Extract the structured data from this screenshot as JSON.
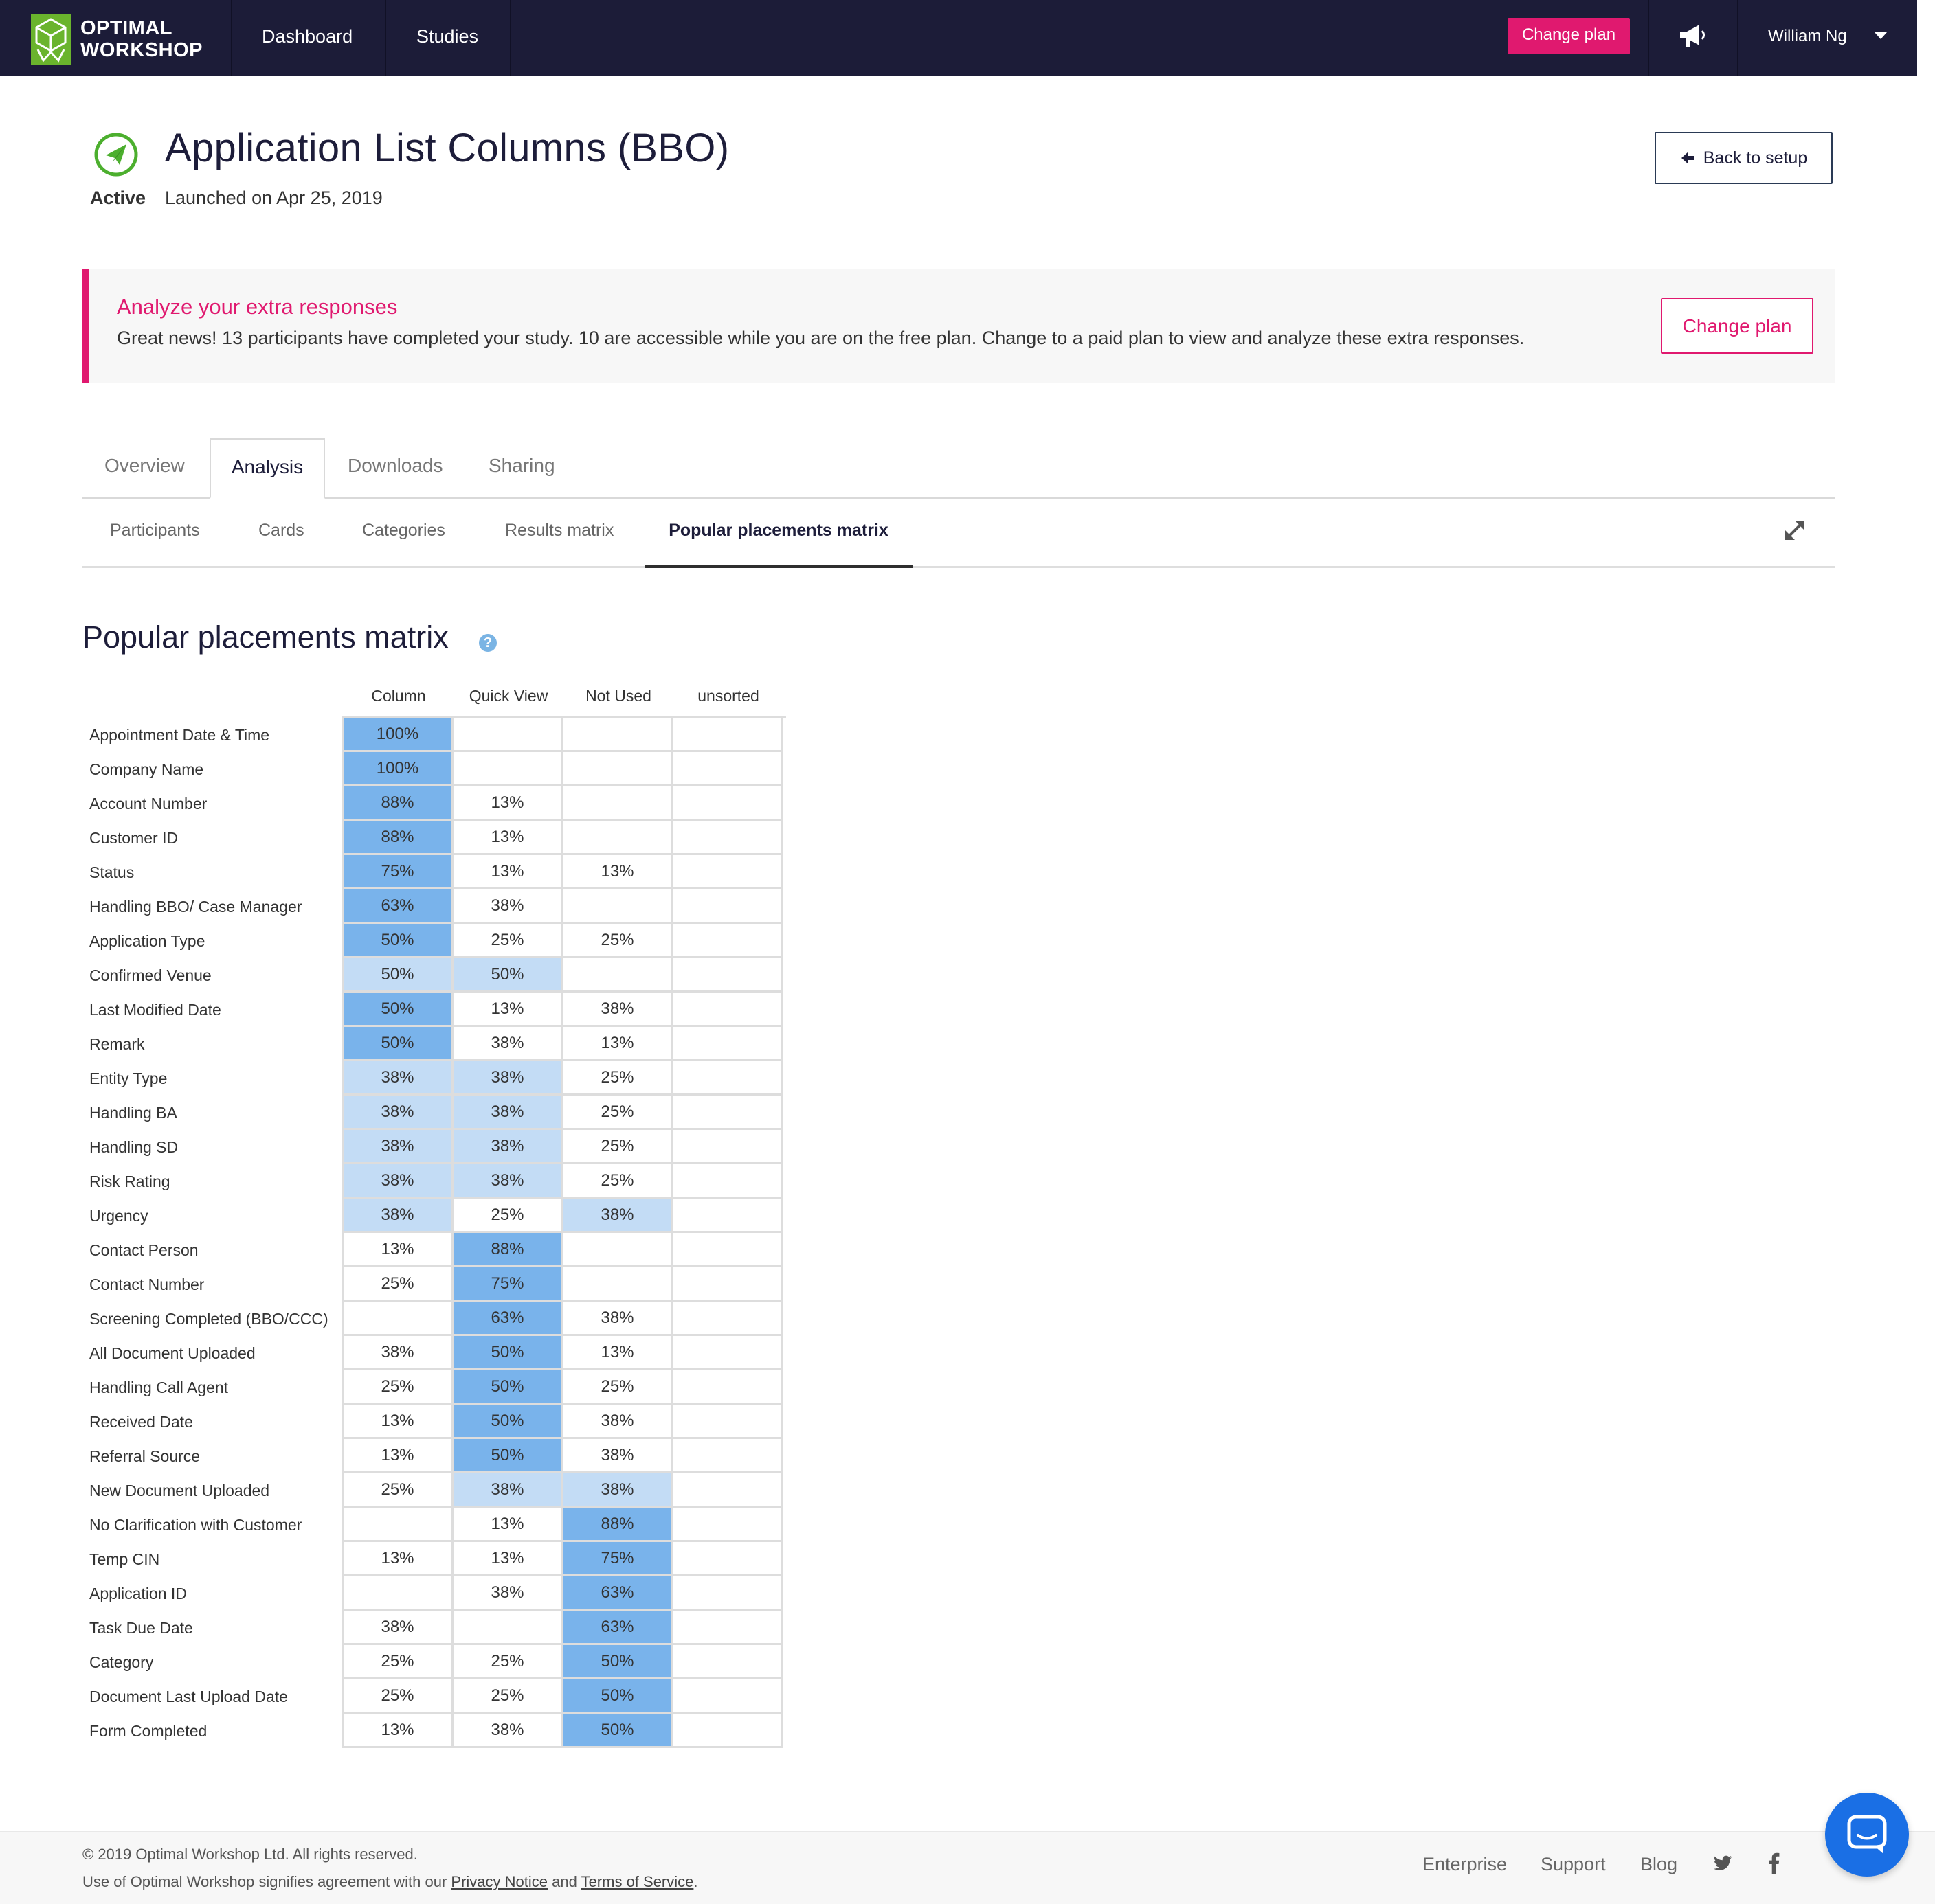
{
  "nav": {
    "brand_line1": "OPTIMAL",
    "brand_line2": "WORKSHOP",
    "links": [
      "Dashboard",
      "Studies"
    ],
    "cta": "Change plan",
    "user": "William Ng",
    "icons": {
      "logo": "optimal-workshop-logo",
      "announcements": "megaphone-icon",
      "menu": "caret-down-icon"
    }
  },
  "header": {
    "title": "Application List Columns (BBO)",
    "status": "Active",
    "launched": "Launched on Apr 25, 2019",
    "back_button": "Back to setup"
  },
  "banner": {
    "title": "Analyze your extra responses",
    "body": "Great news! 13 participants have completed your study. 10 are accessible while you are on the free plan. Change to a paid plan to view and analyze these extra responses.",
    "button": "Change plan"
  },
  "tabs": [
    "Overview",
    "Analysis",
    "Downloads",
    "Sharing"
  ],
  "active_tab": "Analysis",
  "subtabs": [
    "Participants",
    "Cards",
    "Categories",
    "Results matrix",
    "Popular placements matrix"
  ],
  "active_subtab": "Popular placements matrix",
  "matrix": {
    "title": "Popular placements matrix",
    "columns": [
      "Column",
      "Quick View",
      "Not Used",
      "unsorted"
    ],
    "colors": {
      "strong": "#79b3eb",
      "light": "#c3dcf5",
      "none": "#ffffff",
      "border": "#dddddd"
    },
    "rows": [
      {
        "label": "Appointment Date & Time",
        "cells": [
          "100%",
          "",
          "",
          ""
        ],
        "shade": [
          "strong",
          "none",
          "none",
          "none"
        ]
      },
      {
        "label": "Company Name",
        "cells": [
          "100%",
          "",
          "",
          ""
        ],
        "shade": [
          "strong",
          "none",
          "none",
          "none"
        ]
      },
      {
        "label": "Account Number",
        "cells": [
          "88%",
          "13%",
          "",
          ""
        ],
        "shade": [
          "strong",
          "none",
          "none",
          "none"
        ]
      },
      {
        "label": "Customer ID",
        "cells": [
          "88%",
          "13%",
          "",
          ""
        ],
        "shade": [
          "strong",
          "none",
          "none",
          "none"
        ]
      },
      {
        "label": "Status",
        "cells": [
          "75%",
          "13%",
          "13%",
          ""
        ],
        "shade": [
          "strong",
          "none",
          "none",
          "none"
        ]
      },
      {
        "label": "Handling BBO/ Case Manager",
        "cells": [
          "63%",
          "38%",
          "",
          ""
        ],
        "shade": [
          "strong",
          "none",
          "none",
          "none"
        ]
      },
      {
        "label": "Application Type",
        "cells": [
          "50%",
          "25%",
          "25%",
          ""
        ],
        "shade": [
          "strong",
          "none",
          "none",
          "none"
        ]
      },
      {
        "label": "Confirmed Venue",
        "cells": [
          "50%",
          "50%",
          "",
          ""
        ],
        "shade": [
          "light",
          "light",
          "none",
          "none"
        ]
      },
      {
        "label": "Last Modified Date",
        "cells": [
          "50%",
          "13%",
          "38%",
          ""
        ],
        "shade": [
          "strong",
          "none",
          "none",
          "none"
        ]
      },
      {
        "label": "Remark",
        "cells": [
          "50%",
          "38%",
          "13%",
          ""
        ],
        "shade": [
          "strong",
          "none",
          "none",
          "none"
        ]
      },
      {
        "label": "Entity Type",
        "cells": [
          "38%",
          "38%",
          "25%",
          ""
        ],
        "shade": [
          "light",
          "light",
          "none",
          "none"
        ]
      },
      {
        "label": "Handling BA",
        "cells": [
          "38%",
          "38%",
          "25%",
          ""
        ],
        "shade": [
          "light",
          "light",
          "none",
          "none"
        ]
      },
      {
        "label": "Handling SD",
        "cells": [
          "38%",
          "38%",
          "25%",
          ""
        ],
        "shade": [
          "light",
          "light",
          "none",
          "none"
        ]
      },
      {
        "label": "Risk Rating",
        "cells": [
          "38%",
          "38%",
          "25%",
          ""
        ],
        "shade": [
          "light",
          "light",
          "none",
          "none"
        ]
      },
      {
        "label": "Urgency",
        "cells": [
          "38%",
          "25%",
          "38%",
          ""
        ],
        "shade": [
          "light",
          "none",
          "light",
          "none"
        ]
      },
      {
        "label": "Contact Person",
        "cells": [
          "13%",
          "88%",
          "",
          ""
        ],
        "shade": [
          "none",
          "strong",
          "none",
          "none"
        ]
      },
      {
        "label": "Contact Number",
        "cells": [
          "25%",
          "75%",
          "",
          ""
        ],
        "shade": [
          "none",
          "strong",
          "none",
          "none"
        ]
      },
      {
        "label": "Screening Completed (BBO/CCC)",
        "cells": [
          "",
          "63%",
          "38%",
          ""
        ],
        "shade": [
          "none",
          "strong",
          "none",
          "none"
        ]
      },
      {
        "label": "All Document Uploaded",
        "cells": [
          "38%",
          "50%",
          "13%",
          ""
        ],
        "shade": [
          "none",
          "strong",
          "none",
          "none"
        ]
      },
      {
        "label": "Handling Call Agent",
        "cells": [
          "25%",
          "50%",
          "25%",
          ""
        ],
        "shade": [
          "none",
          "strong",
          "none",
          "none"
        ]
      },
      {
        "label": "Received Date",
        "cells": [
          "13%",
          "50%",
          "38%",
          ""
        ],
        "shade": [
          "none",
          "strong",
          "none",
          "none"
        ]
      },
      {
        "label": "Referral Source",
        "cells": [
          "13%",
          "50%",
          "38%",
          ""
        ],
        "shade": [
          "none",
          "strong",
          "none",
          "none"
        ]
      },
      {
        "label": "New Document Uploaded",
        "cells": [
          "25%",
          "38%",
          "38%",
          ""
        ],
        "shade": [
          "none",
          "light",
          "light",
          "none"
        ]
      },
      {
        "label": "No Clarification with Customer",
        "cells": [
          "",
          "13%",
          "88%",
          ""
        ],
        "shade": [
          "none",
          "none",
          "strong",
          "none"
        ]
      },
      {
        "label": "Temp CIN",
        "cells": [
          "13%",
          "13%",
          "75%",
          ""
        ],
        "shade": [
          "none",
          "none",
          "strong",
          "none"
        ]
      },
      {
        "label": "Application ID",
        "cells": [
          "",
          "38%",
          "63%",
          ""
        ],
        "shade": [
          "none",
          "none",
          "strong",
          "none"
        ]
      },
      {
        "label": "Task Due Date",
        "cells": [
          "38%",
          "",
          "63%",
          ""
        ],
        "shade": [
          "none",
          "none",
          "strong",
          "none"
        ]
      },
      {
        "label": "Category",
        "cells": [
          "25%",
          "25%",
          "50%",
          ""
        ],
        "shade": [
          "none",
          "none",
          "strong",
          "none"
        ]
      },
      {
        "label": "Document Last Upload Date",
        "cells": [
          "25%",
          "25%",
          "50%",
          ""
        ],
        "shade": [
          "none",
          "none",
          "strong",
          "none"
        ]
      },
      {
        "label": "Form Completed",
        "cells": [
          "13%",
          "38%",
          "50%",
          ""
        ],
        "shade": [
          "none",
          "none",
          "strong",
          "none"
        ]
      }
    ]
  },
  "footer": {
    "copyright": "© 2019 Optimal Workshop Ltd. All rights reserved.",
    "legal_prefix": "Use of Optimal Workshop signifies agreement with our",
    "privacy": "Privacy Notice",
    "legal_and": "and",
    "terms": "Terms of Service",
    "legal_suffix": ".",
    "links": [
      "Enterprise",
      "Support",
      "Blog"
    ],
    "social": [
      "twitter-icon",
      "facebook-icon"
    ]
  },
  "chat": {
    "icon": "chat-icon"
  }
}
